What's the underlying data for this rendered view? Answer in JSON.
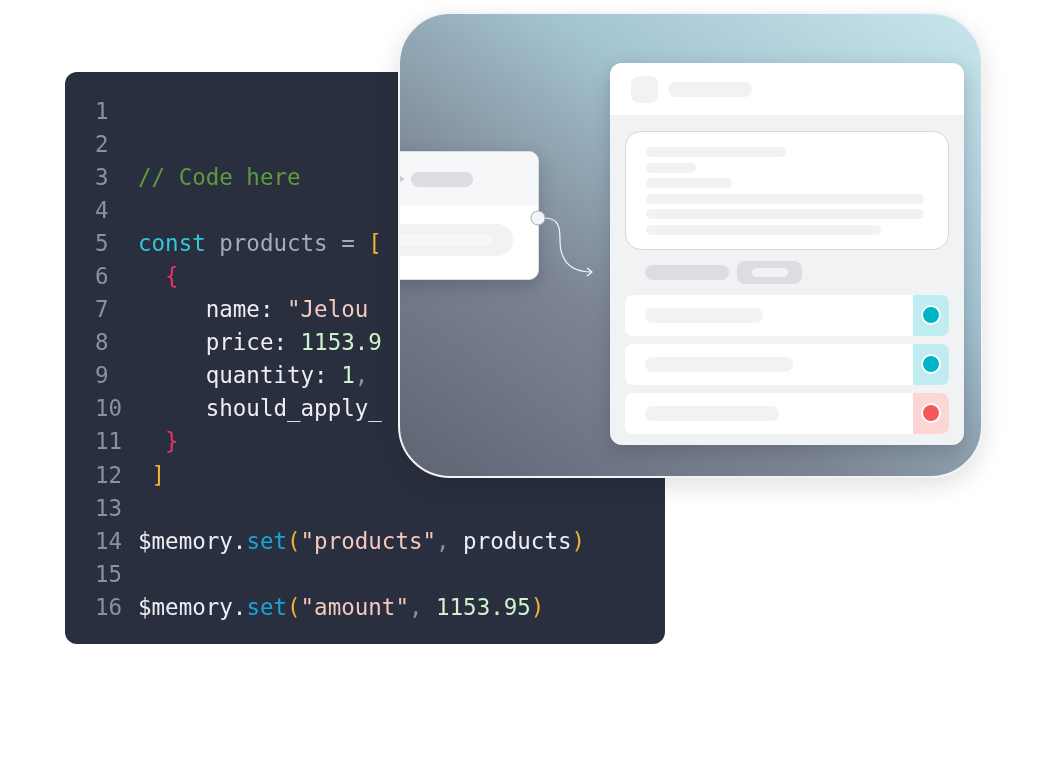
{
  "editor": {
    "lines": [
      {
        "number": "1"
      },
      {
        "number": "2"
      },
      {
        "number": "3",
        "tokens": [
          {
            "text": "// Code here",
            "kind": "comment"
          }
        ]
      },
      {
        "number": "4"
      },
      {
        "number": "5",
        "tokens": [
          {
            "text": "const",
            "kind": "keyword"
          },
          {
            "text": " products =",
            "kind": "ident"
          },
          {
            "text": " [",
            "kind": "bracket"
          }
        ]
      },
      {
        "number": "6",
        "tokens": [
          {
            "text": "  {",
            "kind": "brace"
          }
        ]
      },
      {
        "number": "7",
        "tokens": [
          {
            "text": "     name: ",
            "kind": "plain"
          },
          {
            "text": "\"Jelou",
            "kind": "string"
          }
        ]
      },
      {
        "number": "8",
        "tokens": [
          {
            "text": "     price: ",
            "kind": "plain"
          },
          {
            "text": "1153.9",
            "kind": "number"
          }
        ]
      },
      {
        "number": "9",
        "tokens": [
          {
            "text": "     quantity: ",
            "kind": "plain"
          },
          {
            "text": "1",
            "kind": "number"
          },
          {
            "text": ",",
            "kind": "punct"
          }
        ]
      },
      {
        "number": "10",
        "tokens": [
          {
            "text": "     should_apply_",
            "kind": "plain"
          }
        ]
      },
      {
        "number": "11",
        "tokens": [
          {
            "text": "  }",
            "kind": "brace"
          }
        ]
      },
      {
        "number": "12",
        "tokens": [
          {
            "text": " ]",
            "kind": "bracket"
          }
        ]
      },
      {
        "number": "13"
      },
      {
        "number": "14",
        "tokens": [
          {
            "text": "$memory.",
            "kind": "plain"
          },
          {
            "text": "set",
            "kind": "method"
          },
          {
            "text": "(",
            "kind": "bracket"
          },
          {
            "text": "\"products\"",
            "kind": "string"
          },
          {
            "text": ",",
            "kind": "punct"
          },
          {
            "text": " products",
            "kind": "plain"
          },
          {
            "text": ")",
            "kind": "bracket"
          }
        ]
      },
      {
        "number": "15"
      },
      {
        "number": "16",
        "tokens": [
          {
            "text": "$memory.",
            "kind": "plain"
          },
          {
            "text": "set",
            "kind": "method"
          },
          {
            "text": "(",
            "kind": "bracket"
          },
          {
            "text": "\"amount\"",
            "kind": "string"
          },
          {
            "text": ",",
            "kind": "punct"
          },
          {
            "text": " 1153.95",
            "kind": "number"
          },
          {
            "text": ")",
            "kind": "bracket"
          }
        ]
      }
    ]
  },
  "flow": {
    "status_rows": [
      {
        "color": "#00b4c8"
      },
      {
        "color": "#00b4c8"
      },
      {
        "color": "#f25a57"
      }
    ]
  }
}
